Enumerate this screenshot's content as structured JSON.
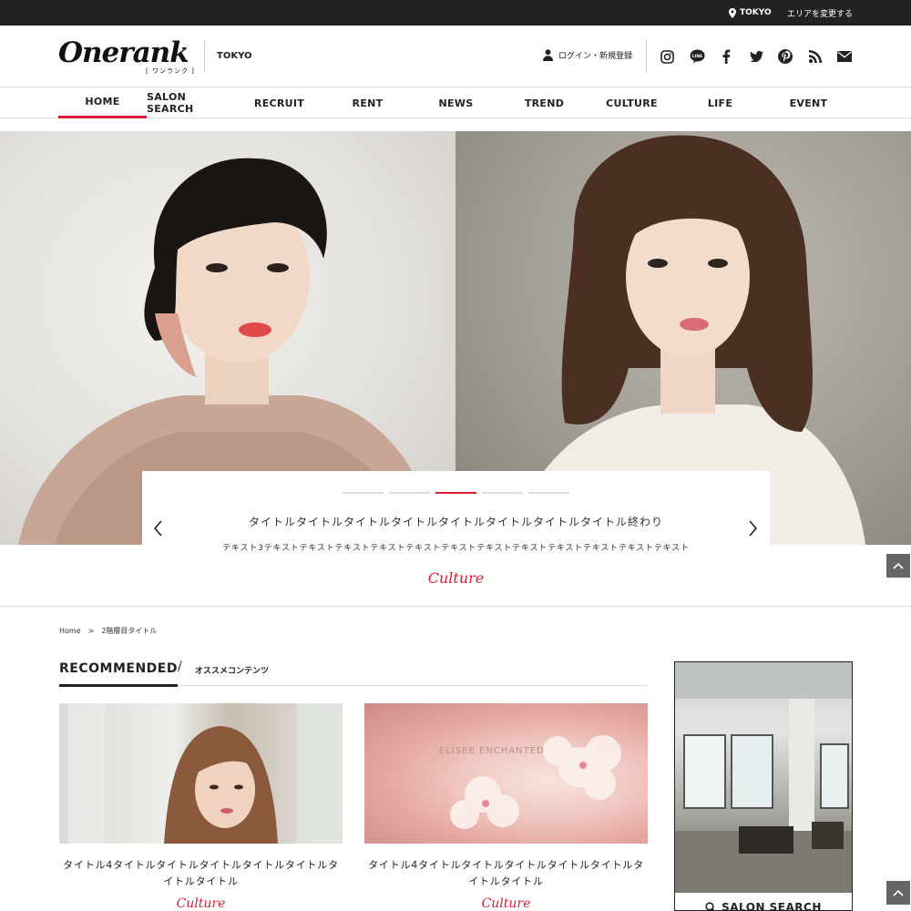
{
  "topbar": {
    "location": "TOKYO",
    "change_area": "エリアを変更する"
  },
  "header": {
    "logo_text": "Onerank",
    "logo_kana": "[ ワンランク ]",
    "city": "TOKYO",
    "login": "ログイン・新規登録",
    "social": [
      "instagram-icon",
      "line-icon",
      "facebook-icon",
      "twitter-icon",
      "pinterest-icon",
      "rss-icon",
      "mail-icon"
    ]
  },
  "nav": {
    "items": [
      "HOME",
      "SALON SEARCH",
      "RECRUIT",
      "RENT",
      "NEWS",
      "TREND",
      "CULTURE",
      "LIFE",
      "EVENT"
    ],
    "active": "HOME"
  },
  "hero": {
    "slide_count": 5,
    "active_slide": 3,
    "title": "タイトルタイトルタイトルタイトルタイトルタイトルタイトルタイトル終わり",
    "text": "テキスト3テキストテキストテキストテキストテキストテキストテキストテキストテキストテキストテキストテキスト",
    "category": "Culture"
  },
  "breadcrumb": {
    "home": "Home",
    "separator": ">",
    "current": "2階層目タイトル"
  },
  "recommended": {
    "title": "RECOMMENDED",
    "slash": "/",
    "subtitle": "オススメコンテンツ",
    "articles": [
      {
        "title": "タイトル4タイトルタイトルタイトルタイトルタイトルタイトルタイトル",
        "category": "Culture"
      },
      {
        "title": "タイトル4タイトルタイトルタイトルタイトルタイトルタイトルタイトル",
        "category": "Culture",
        "image_text": "ELISEE ENCHANTED"
      }
    ]
  },
  "side_banner": {
    "label": "SALON SEARCH"
  },
  "colors": {
    "accent": "#d81f35",
    "topbar": "#222222"
  }
}
